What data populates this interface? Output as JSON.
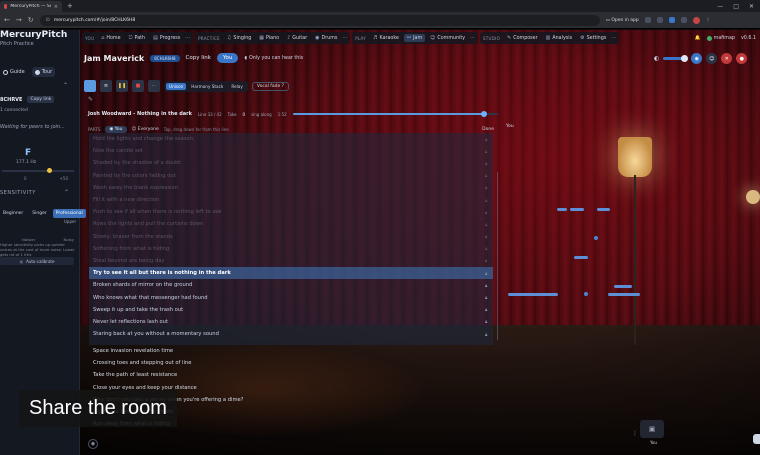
{
  "browser": {
    "tab_title": "MercuryPitch — Sing You...",
    "url": "mercurypitch.com/#/join/8CHLK6H8",
    "open_in_app": "Open in app",
    "new_tab": "+",
    "minimize": "—",
    "maximize": "□",
    "close": "✕"
  },
  "sidebar": {
    "title": "MercuryPitch",
    "subtitle": "Pitch Practice",
    "tabs": [
      {
        "label": "Guide"
      },
      {
        "label": "Tour"
      }
    ],
    "room_code": "8CHRVE",
    "copy_code": "Copy link",
    "connected": "1 connected",
    "waiting": "Waiting for peers to join...",
    "note": "F",
    "hz": "177.1 Hz",
    "tuner_min": "0",
    "tuner_max": "+50",
    "tuner_level": 0.62,
    "sensitivity_heading": "SENSITIVITY",
    "sens_opts": [
      "Beginner",
      "Singer",
      "Professional"
    ],
    "sens_active_label": "Upper",
    "sens_low": "Noisier",
    "sens_high": "Noisy",
    "sens_desc": "Higher sensitivity picks up quieter voices at the cost of more noise. Lower gets rid of 1 KHz",
    "auto_calibrate": "Auto-calibrate"
  },
  "topnav": {
    "groups": [
      {
        "label": "YOU",
        "items": [
          {
            "icon": "⌂",
            "label": "Home"
          },
          {
            "icon": "⎋",
            "label": "Path"
          },
          {
            "icon": "▤",
            "label": "Progress"
          }
        ]
      },
      {
        "label": "PRACTICE",
        "items": [
          {
            "icon": "♫",
            "label": "Singing"
          },
          {
            "icon": "▦",
            "label": "Piano"
          },
          {
            "icon": "♪",
            "label": "Guitar"
          },
          {
            "icon": "◉",
            "label": "Drums"
          }
        ]
      },
      {
        "label": "PLAY",
        "items": [
          {
            "icon": "♬",
            "label": "Karaoke"
          },
          {
            "icon": "⚯",
            "label": "Jam",
            "active": true
          },
          {
            "icon": "☺",
            "label": "Community"
          }
        ]
      },
      {
        "label": "STUDIO",
        "items": [
          {
            "icon": "✎",
            "label": "Composer"
          },
          {
            "icon": "▥",
            "label": "Analysis"
          },
          {
            "icon": "⚙",
            "label": "Settings"
          }
        ]
      }
    ],
    "more": "···",
    "user": "mafimap",
    "version": "v0.6.1"
  },
  "room": {
    "name": "Jam Maverick",
    "code": "8CHLK6H8",
    "copy_link": "Copy link",
    "you": "You",
    "only_you": "Only you can hear this"
  },
  "toolbar": {
    "play_icon": "▶",
    "pause_icon": "❚❚",
    "stop_icon": "■",
    "modes": [
      "Unison",
      "Harmony Stack",
      "Relay"
    ],
    "active_mode": 0,
    "vfade": "Vocal fade"
  },
  "song": {
    "title": "Josh Woodward - Nothing in the dark",
    "length": "Line 33 / 42",
    "take_label": "Take",
    "take_value": "0",
    "sing_along": "sing along",
    "time": "1:52",
    "progress": 0.93
  },
  "parts": {
    "label": "PARTS",
    "you": "You",
    "everyone": "Everyone",
    "hint": "Tap, drag down for from this line",
    "done": "Done"
  },
  "lyrics_dim": [
    "Hold the lights and change the season",
    "Now the candle set",
    "Shaded by the shadow of a doubt",
    "Painted by the colors fading out",
    "Wash away the blank expression",
    "Fill it with a new direction",
    "Push to see if all when there is nothing left to see",
    "Rows the lights and pull the curtains down",
    "Slowly, braver from the stands",
    "Softening from what is hiding",
    "Steal beyond are being day"
  ],
  "lyric_current": "Try to see it all but there is nothing in the dark",
  "lyrics_active": [
    "Broken shards of mirror on the ground",
    "Who knows what that messenger had found",
    "Sweep it up and take the trash out",
    "Never let reflections lash out",
    "Staring back at you without a momentary sound"
  ],
  "lyrics_after": [
    "Space invasion revelation time",
    "Crossing toes and stepping out of line",
    "Take the path of least resistance",
    "Close your eyes and keep your distance",
    "Why don't you take a penny when you're offering a dime?",
    "Lights are low under the shade",
    "Run away from what is hiding"
  ],
  "lane": {
    "label": "You",
    "pip_label": "You"
  },
  "caption": "Share the room"
}
